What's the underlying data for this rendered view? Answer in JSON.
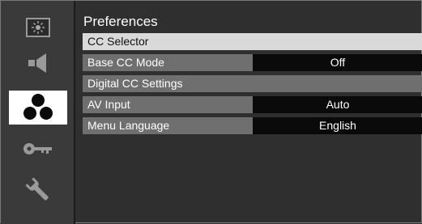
{
  "sidebar": {
    "items": [
      {
        "icon": "picture-icon",
        "active": false
      },
      {
        "icon": "speaker-icon",
        "active": false
      },
      {
        "icon": "preferences-circles-icon",
        "active": true
      },
      {
        "icon": "key-icon",
        "active": false
      },
      {
        "icon": "wrench-icon",
        "active": false
      }
    ]
  },
  "main": {
    "title": "Preferences",
    "rows": [
      {
        "label": "CC Selector",
        "value": null
      },
      {
        "label": "Base CC Mode",
        "value": "Off"
      },
      {
        "label": "Digital CC Settings",
        "value": null
      },
      {
        "label": "AV Input",
        "value": "Auto"
      },
      {
        "label": "Menu Language",
        "value": "English"
      }
    ]
  },
  "colors": {
    "background": "#2f2f2f",
    "row_label": "#6f6f6f",
    "row_selected": "#d9d9d9",
    "row_value": "#0a0a0a",
    "sidebar_active": "#ffffff"
  }
}
